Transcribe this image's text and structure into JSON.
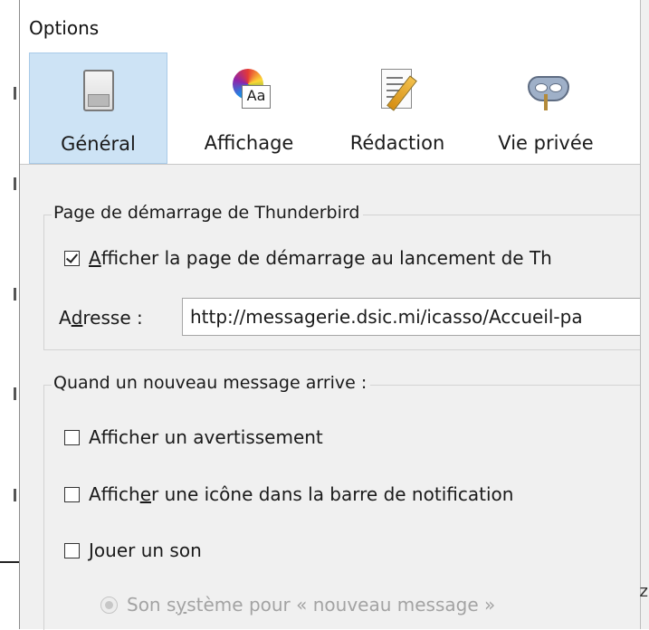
{
  "window": {
    "title": "Options"
  },
  "toolbar": {
    "tabs": [
      {
        "label": "Général",
        "icon": "general-switch-icon",
        "selected": true
      },
      {
        "label": "Affichage",
        "icon": "palette-icon",
        "selected": false
      },
      {
        "label": "Rédaction",
        "icon": "compose-pen-icon",
        "selected": false
      },
      {
        "label": "Vie privée",
        "icon": "mask-icon",
        "selected": false
      }
    ]
  },
  "startup": {
    "legend": "Page de démarrage de Thunderbird",
    "show_start_page": {
      "accel": "A",
      "rest": "fficher la page de démarrage au lancement de Th",
      "checked": true
    },
    "address": {
      "label_pre": "A",
      "accel": "d",
      "label_post": "resse :",
      "value": "http://messagerie.dsic.mi/icasso/Accueil-pa"
    }
  },
  "new_message": {
    "legend": "Quand un nouveau message arrive :",
    "show_alert": {
      "pre": "Af",
      "accel": "f",
      "post": "icher un avertissement",
      "checked": false
    },
    "show_tray_icon": {
      "pre": "Affich",
      "accel": "e",
      "post": "r une icône dans la barre de notification",
      "checked": false
    },
    "play_sound": {
      "accel": "J",
      "post": "ouer un son",
      "checked": false
    },
    "system_sound": {
      "pre": "Son s",
      "accel": "y",
      "post": "stème pour « nouveau message »",
      "enabled": false
    }
  },
  "colors": {
    "selected_tab_bg": "#cde3f5",
    "window_bg": "#f0f0f0"
  }
}
